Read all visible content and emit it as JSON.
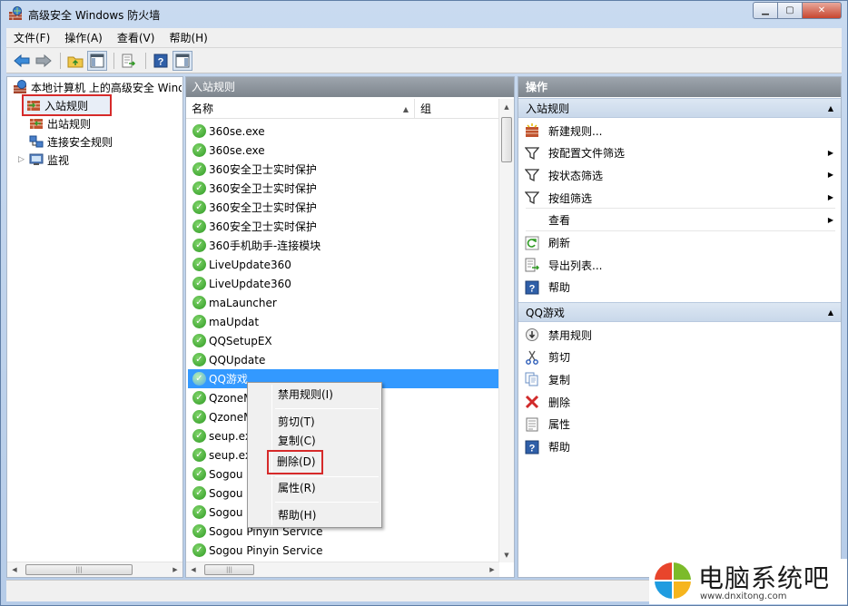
{
  "window": {
    "title": "高级安全 Windows 防火墙"
  },
  "menu": [
    "文件(F)",
    "操作(A)",
    "查看(V)",
    "帮助(H)"
  ],
  "tree": {
    "root": "本地计算机 上的高级安全 Windows 防火墙",
    "items": [
      "入站规则",
      "出站规则",
      "连接安全规则",
      "监视"
    ]
  },
  "middle": {
    "header": "入站规则",
    "col_name": "名称",
    "col_group": "组",
    "rows": [
      "360se.exe",
      "360se.exe",
      "360安全卫士实时保护",
      "360安全卫士实时保护",
      "360安全卫士实时保护",
      "360安全卫士实时保护",
      "360手机助手-连接模块",
      "LiveUpdate360",
      "LiveUpdate360",
      "maLauncher",
      "maUpdat",
      "QQSetupEX",
      "QQUpdate",
      "QQ游戏",
      "QzoneM",
      "QzoneM",
      "seup.ex",
      "seup.ex",
      "Sogou",
      "Sogou",
      "Sogou",
      "Sogou Pinyin Service",
      "Sogou Pinyin Service"
    ],
    "selected_index": 13
  },
  "context_menu": {
    "items": [
      "禁用规则(I)",
      "剪切(T)",
      "复制(C)",
      "删除(D)",
      "属性(R)",
      "帮助(H)"
    ]
  },
  "actions": {
    "header": "操作",
    "section1": {
      "title": "入站规则",
      "items": [
        {
          "label": "新建规则...",
          "icon": "new-rule-icon"
        },
        {
          "label": "按配置文件筛选",
          "icon": "filter-icon",
          "submenu": true
        },
        {
          "label": "按状态筛选",
          "icon": "filter-icon",
          "submenu": true
        },
        {
          "label": "按组筛选",
          "icon": "filter-icon",
          "submenu": true
        },
        {
          "label": "查看",
          "icon": "",
          "submenu": true
        },
        {
          "label": "刷新",
          "icon": "refresh-icon"
        },
        {
          "label": "导出列表...",
          "icon": "export-icon"
        },
        {
          "label": "帮助",
          "icon": "help-icon"
        }
      ]
    },
    "section2": {
      "title": "QQ游戏",
      "items": [
        {
          "label": "禁用规则",
          "icon": "disable-icon"
        },
        {
          "label": "剪切",
          "icon": "cut-icon"
        },
        {
          "label": "复制",
          "icon": "copy-icon"
        },
        {
          "label": "删除",
          "icon": "delete-icon"
        },
        {
          "label": "属性",
          "icon": "properties-icon"
        },
        {
          "label": "帮助",
          "icon": "help-icon"
        }
      ]
    }
  },
  "watermark": {
    "title": "电脑系统吧",
    "url": "www.dnxitong.com"
  },
  "colors": {
    "selection": "#3399ff",
    "highlight_box": "#d62a2a",
    "check": "#2f9a23"
  }
}
